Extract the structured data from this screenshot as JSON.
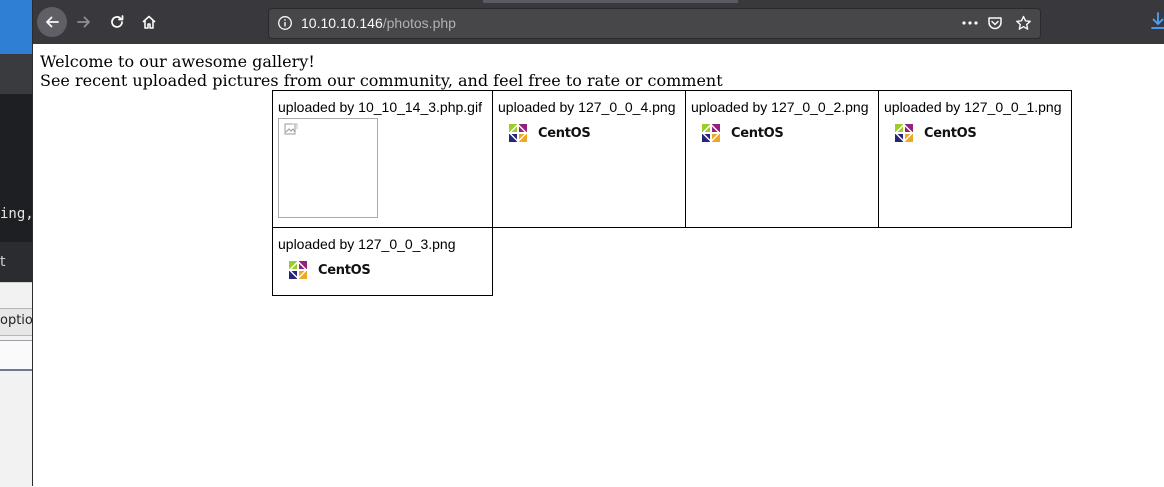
{
  "background_window": {
    "terminal_text": "ing,",
    "panel_text": "t",
    "options_text": "optio"
  },
  "browser": {
    "url_host": "10.10.10.146",
    "url_path": "/photos.php",
    "accent_color": "#38383d"
  },
  "page": {
    "welcome": "Welcome to our awesome gallery!",
    "subtitle": "See recent uploaded pictures from our community, and feel free to rate or comment"
  },
  "gallery": {
    "items": [
      {
        "label": "uploaded by 10_10_14_3.php.gif",
        "image": "broken-image"
      },
      {
        "label": "uploaded by 127_0_0_4.png",
        "image": "centos-logo",
        "logo_text": "CentOS"
      },
      {
        "label": "uploaded by 127_0_0_2.png",
        "image": "centos-logo",
        "logo_text": "CentOS"
      },
      {
        "label": "uploaded by 127_0_0_1.png",
        "image": "centos-logo",
        "logo_text": "CentOS"
      },
      {
        "label": "uploaded by 127_0_0_3.png",
        "image": "centos-logo",
        "logo_text": "CentOS"
      }
    ]
  }
}
